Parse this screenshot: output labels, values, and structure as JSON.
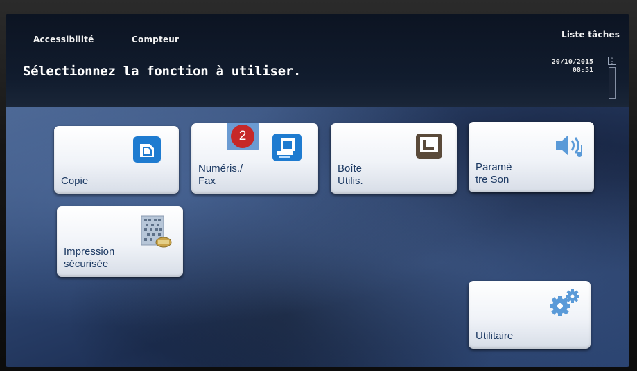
{
  "header": {
    "accessibility_label": "Accessibilité",
    "counter_label": "Compteur",
    "job_list_label": "Liste tâches",
    "instruction": "Sélectionnez la fonction à utiliser.",
    "date": "20/10/2015",
    "time": "08:51"
  },
  "tiles": {
    "copy": "Copie",
    "scan_fax_line1": "Numéris./",
    "scan_fax_line2": "Fax",
    "user_box_line1": "Boîte",
    "user_box_line2": "Utilis.",
    "sound_line1": "Paramè",
    "sound_line2": "tre Son",
    "secure_print_line1": "Impression",
    "secure_print_line2": "sécurisée",
    "utility": "Utilitaire"
  },
  "annotation": {
    "step_number": "2"
  }
}
